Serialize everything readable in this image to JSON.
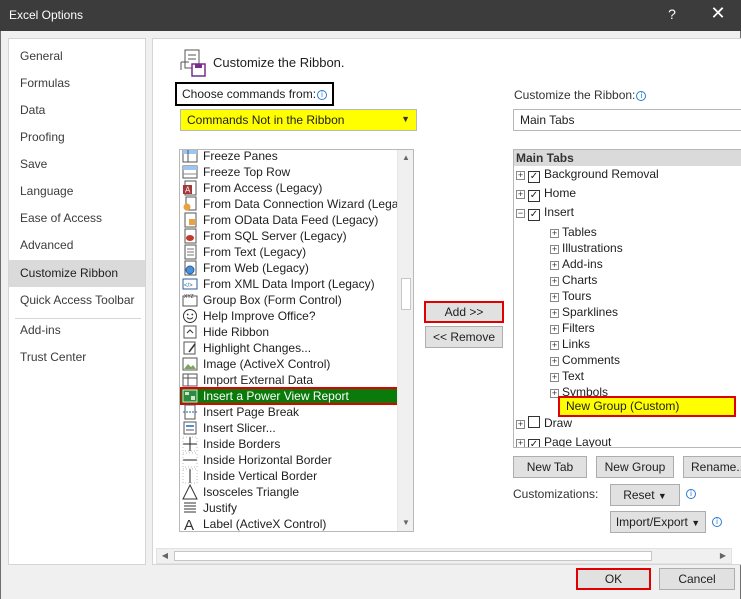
{
  "window": {
    "title": "Excel Options",
    "help": "?",
    "close": "✕"
  },
  "sidebar": {
    "items": [
      {
        "label": "General"
      },
      {
        "label": "Formulas"
      },
      {
        "label": "Data"
      },
      {
        "label": "Proofing"
      },
      {
        "label": "Save"
      },
      {
        "label": "Language"
      },
      {
        "label": "Ease of Access"
      },
      {
        "label": "Advanced"
      },
      {
        "label": "Customize Ribbon",
        "active": true
      },
      {
        "label": "Quick Access Toolbar"
      },
      {
        "label": "Add-ins"
      },
      {
        "label": "Trust Center"
      }
    ]
  },
  "header": {
    "title": "Customize the Ribbon."
  },
  "choose": {
    "label": "Choose commands from:",
    "info": "i",
    "value": "Commands Not in the Ribbon",
    "arrow": "▼"
  },
  "ribbon": {
    "label": "Customize the Ribbon:",
    "info": "i",
    "value": "Main Tabs"
  },
  "commands": {
    "items": [
      {
        "label": "Freeze Panes",
        "icon": "freeze-panes-icon"
      },
      {
        "label": "Freeze Top Row",
        "icon": "freeze-top-row-icon"
      },
      {
        "label": "From Access (Legacy)",
        "icon": "access-icon"
      },
      {
        "label": "From Data Connection Wizard (Legacy)",
        "icon": "data-connection-icon"
      },
      {
        "label": "From OData Data Feed (Legacy)",
        "icon": "odata-feed-icon"
      },
      {
        "label": "From SQL Server (Legacy)",
        "icon": "sql-server-icon"
      },
      {
        "label": "From Text (Legacy)",
        "icon": "text-file-icon"
      },
      {
        "label": "From Web (Legacy)",
        "icon": "web-icon"
      },
      {
        "label": "From XML Data Import (Legacy)",
        "icon": "xml-icon"
      },
      {
        "label": "Group Box (Form Control)",
        "icon": "group-box-icon"
      },
      {
        "label": "Help Improve Office?",
        "icon": "smiley-icon"
      },
      {
        "label": "Hide Ribbon",
        "icon": "hide-ribbon-icon"
      },
      {
        "label": "Highlight Changes...",
        "icon": "highlight-changes-icon"
      },
      {
        "label": "Image (ActiveX Control)",
        "icon": "image-control-icon"
      },
      {
        "label": "Import External Data",
        "icon": "import-data-icon"
      },
      {
        "label": "Insert a Power View Report",
        "icon": "power-view-icon",
        "selected": true
      },
      {
        "label": "Insert Page Break",
        "icon": "page-break-icon"
      },
      {
        "label": "Insert Slicer...",
        "icon": "slicer-icon"
      },
      {
        "label": "Inside Borders",
        "icon": "inside-borders-icon"
      },
      {
        "label": "Inside Horizontal Border",
        "icon": "inside-horizontal-border-icon"
      },
      {
        "label": "Inside Vertical Border",
        "icon": "inside-vertical-border-icon"
      },
      {
        "label": "Isosceles Triangle",
        "icon": "triangle-icon"
      },
      {
        "label": "Justify",
        "icon": "justify-icon"
      },
      {
        "label": "Label (ActiveX Control)",
        "icon": "label-control-icon"
      }
    ]
  },
  "add_label": "Add >>",
  "remove_label": "<< Remove",
  "tree": {
    "head": "Main Tabs",
    "items": [
      {
        "label": "Background Removal",
        "level": 0,
        "pm": "+",
        "check": true
      },
      {
        "label": "Home",
        "level": 0,
        "pm": "+",
        "check": true
      },
      {
        "label": "Insert",
        "level": 0,
        "pm": "−",
        "check": true
      },
      {
        "label": "Tables",
        "level": 1,
        "pm": "+"
      },
      {
        "label": "Illustrations",
        "level": 1,
        "pm": "+"
      },
      {
        "label": "Add-ins",
        "level": 1,
        "pm": "+"
      },
      {
        "label": "Charts",
        "level": 1,
        "pm": "+"
      },
      {
        "label": "Tours",
        "level": 1,
        "pm": "+"
      },
      {
        "label": "Sparklines",
        "level": 1,
        "pm": "+"
      },
      {
        "label": "Filters",
        "level": 1,
        "pm": "+"
      },
      {
        "label": "Links",
        "level": 1,
        "pm": "+"
      },
      {
        "label": "Comments",
        "level": 1,
        "pm": "+"
      },
      {
        "label": "Text",
        "level": 1,
        "pm": "+"
      },
      {
        "label": "Symbols",
        "level": 1,
        "pm": "+"
      },
      {
        "label": "Draw",
        "level": 0,
        "pm": "+",
        "check": false
      },
      {
        "label": "Page Layout",
        "level": 0,
        "pm": "+",
        "check": true
      }
    ],
    "new_group": "New Group (Custom)"
  },
  "new_tab_label": "New Tab",
  "new_group_label": "New Group",
  "rename_label": "Rename...",
  "customizations_label": "Customizations:",
  "reset_label": "Reset",
  "import_export_label": "Import/Export",
  "ok_label": "OK",
  "cancel_label": "Cancel",
  "colors": {
    "highlight_yellow": "#ffff00",
    "selection_green": "#0a7a0a",
    "callout_red": "#e00000"
  }
}
